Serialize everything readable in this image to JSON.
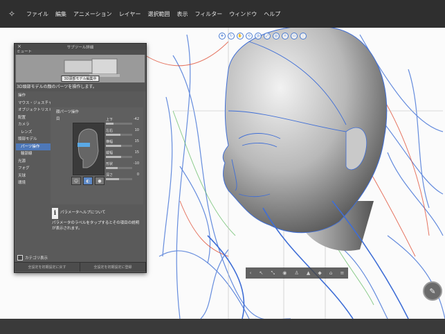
{
  "menubar": {
    "logo_icon": "brush-logo-icon",
    "items": [
      "ファイル",
      "編集",
      "アニメーション",
      "レイヤー",
      "選択範囲",
      "表示",
      "フィルター",
      "ウィンドウ",
      "ヘルプ"
    ]
  },
  "panel": {
    "title": "サブツール詳細",
    "close": "×",
    "preview_header": "ミュート",
    "preview_caption": "3D頭部モデル編集中",
    "description": "3D頭部モデルの顔のパーツを操作します。",
    "categories": [
      {
        "label": "操作"
      },
      {
        "label": "マウス・ジェスチャー"
      },
      {
        "label": "オブジェクトリスト"
      },
      {
        "label": "配置"
      },
      {
        "label": "カメラ"
      },
      {
        "label": "レンズ"
      },
      {
        "label": "頭部モデル"
      },
      {
        "label": "パーツ操作"
      },
      {
        "label": "輪郭線"
      },
      {
        "label": "光源"
      },
      {
        "label": "フォグ"
      },
      {
        "label": "天球"
      },
      {
        "label": "環境"
      }
    ],
    "content_header": "顔パーツ操作",
    "part_label": "目",
    "sliders": [
      {
        "label": "上下",
        "value": "-42",
        "level": 0.29
      },
      {
        "label": "左右",
        "value": "10",
        "level": 0.55
      },
      {
        "label": "横幅",
        "value": "15",
        "level": 0.58
      },
      {
        "label": "縦幅",
        "value": "15",
        "level": 0.58
      },
      {
        "label": "形状",
        "value": "-10",
        "level": 0.45
      },
      {
        "label": "深さ",
        "value": "0",
        "level": 0.5
      }
    ],
    "help_icon": "i",
    "help_title": "パラメータヘルプについて",
    "help_body": "パラメータのラベルをタップするとその項目の説明が表示されます。",
    "category_checkbox": "カテゴリ表示",
    "bottom_buttons": [
      "全設定を初期設定に戻す",
      "全設定を初期設定に登録"
    ]
  },
  "tools3d": {
    "top_icons": [
      "move-icon",
      "rotate-icon",
      "pan-icon",
      "rotate-x-icon",
      "rotate-y-icon",
      "scale-icon",
      "camera-icon",
      "light-icon",
      "ground-icon",
      "grip-icon"
    ],
    "bottom_icons": [
      "prev-icon",
      "select-icon",
      "fit-icon",
      "camera-icon",
      "person-icon",
      "reset-icon",
      "layer-icon",
      "lock-icon",
      "menu-icon"
    ]
  },
  "fab": {
    "icon": "pen-settings-icon",
    "glyph": "✎"
  },
  "colors": {
    "menubar": "#2f2f2f",
    "panel": "#5a5a5a",
    "active_category": "#4e78b8",
    "line_blue": "#3f6ed6",
    "line_red": "#e0523a",
    "line_green": "#5cb85c"
  }
}
